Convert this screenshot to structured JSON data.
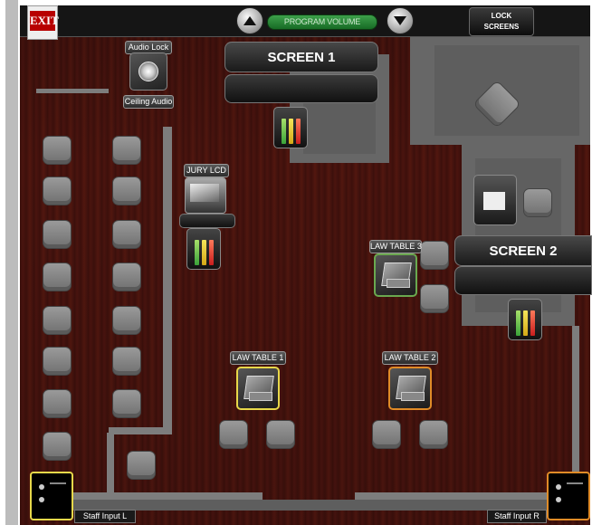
{
  "topbar": {
    "volume_label": "PROGRAM VOLUME",
    "volume_up_icon": "up-arrow-icon",
    "volume_down_icon": "down-arrow-icon",
    "lock_line1": "LOCK",
    "lock_line2": "SCREENS",
    "exit_sign": "EXIT"
  },
  "screens": {
    "screen1": "SCREEN 1",
    "screen2": "SCREEN 2"
  },
  "audio": {
    "lock_label": "Audio Lock",
    "ceiling_label": "Ceiling Audio",
    "icon": "speaker-icon"
  },
  "jury": {
    "label": "JURY LCD",
    "icon": "monitor-icon"
  },
  "tables": [
    {
      "label": "LAW TABLE 1",
      "icon": "laptop-icon",
      "border": "#e7d84a"
    },
    {
      "label": "LAW TABLE 2",
      "icon": "laptop-icon",
      "border": "#e08b27"
    },
    {
      "label": "LAW TABLE 3",
      "icon": "laptop-icon",
      "border": "#6aa84f"
    }
  ],
  "inputs": {
    "left": "Staff Input L",
    "right": "Staff Input R"
  },
  "colors": {
    "floor": "#4b140f",
    "yellow_accent": "#e7d84a",
    "orange_accent": "#e08b27",
    "green_accent": "#6aa84f",
    "volume_green": "#2e8b3c"
  }
}
